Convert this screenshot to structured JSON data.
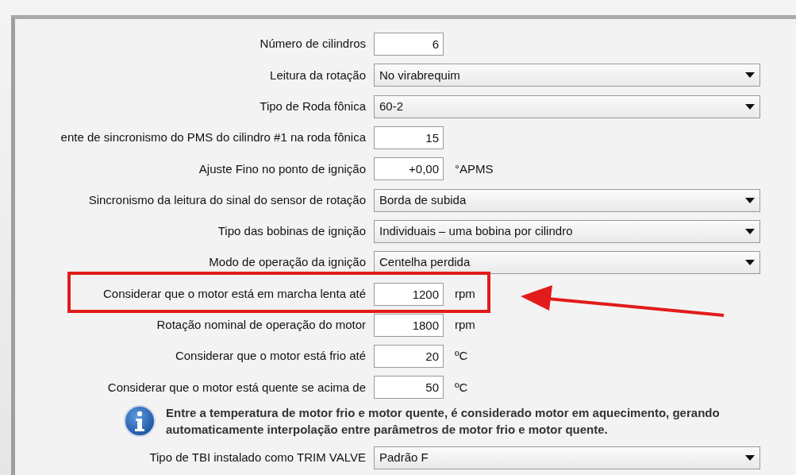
{
  "fields": [
    {
      "label": "Número de cilindros",
      "kind": "number",
      "value": "6",
      "highlighted": false
    },
    {
      "label": "Leitura da rotação",
      "kind": "select",
      "value": "No virabrequim",
      "highlighted": false
    },
    {
      "label": "Tipo de Roda fônica",
      "kind": "select",
      "value": "60-2",
      "highlighted": false
    },
    {
      "label": "ente de sincronismo do PMS do cilindro #1 na roda fônica",
      "kind": "number",
      "value": "15",
      "highlighted": false
    },
    {
      "label": "Ajuste Fino no ponto de ignição",
      "kind": "number",
      "value": "+0,00",
      "unit": "°APMS",
      "highlighted": false
    },
    {
      "label": "Sincronismo da leitura do sinal do sensor de rotação",
      "kind": "select",
      "value": "Borda de subida",
      "highlighted": false
    },
    {
      "label": "Tipo das bobinas de ignição",
      "kind": "select",
      "value": "Individuais – uma bobina por cilindro",
      "highlighted": false
    },
    {
      "label": "Modo de operação da ignição",
      "kind": "select",
      "value": "Centelha perdida",
      "highlighted": false
    },
    {
      "label": "Considerar que o motor está em marcha lenta até",
      "kind": "number",
      "value": "1200",
      "unit": "rpm",
      "highlighted": true
    },
    {
      "label": "Rotação nominal de operação do motor",
      "kind": "number",
      "value": "1800",
      "unit": "rpm",
      "highlighted": false
    },
    {
      "label": "Considerar que o motor está frio até",
      "kind": "number",
      "value": "20",
      "unit": "ºC",
      "highlighted": false
    },
    {
      "label": "Considerar que o motor está quente se acima de",
      "kind": "number",
      "value": "50",
      "unit": "ºC",
      "highlighted": false
    },
    {
      "kind": "info",
      "text": "Entre a temperatura de motor frio e motor quente, é considerado motor em aquecimento, gerando automaticamente interpolação entre parâmetros de motor frio e motor quente."
    },
    {
      "label": "Tipo de TBI instalado como TRIM VALVE",
      "kind": "select",
      "value": "Padrão F",
      "highlighted": false
    }
  ]
}
